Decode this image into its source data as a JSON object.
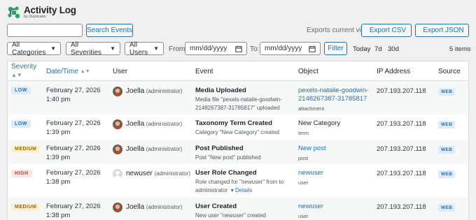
{
  "header": {
    "title": "Activity Log",
    "subtitle": "by Duplicator"
  },
  "search": {
    "placeholder": "",
    "value": "",
    "button_label": "Search Events"
  },
  "exports": {
    "note": "Exports current view",
    "csv_label": "Export CSV",
    "json_label": "Export JSON"
  },
  "filters": {
    "category": "All Categories",
    "severity": "All Severities",
    "users": "All Users",
    "from_label": "From:",
    "from_placeholder": "mm/dd/yyyy",
    "to_label": "To:",
    "to_placeholder": "mm/dd/yyyy",
    "filter_button": "Filter",
    "quick": [
      "Today",
      "7d",
      "30d"
    ],
    "count": "5 items"
  },
  "columns": [
    "Severity",
    "Date/Time",
    "User",
    "Event",
    "Object",
    "IP Address",
    "Source"
  ],
  "rows": [
    {
      "severity": "LOW",
      "date": "February 27, 2026",
      "time": "1:40 pm",
      "user": "Joella",
      "role": "(administrator)",
      "event": "Media Uploaded",
      "desc1": "Media file \"pexels-natalie-goodwin-",
      "desc2": "2148267387-31785817\" uploaded",
      "object1": "pexels-natalie-goodwin-",
      "object2": "2148267387-31785817",
      "object_type": "attachment",
      "ip": "207.193.207.118",
      "source": "WEB"
    },
    {
      "severity": "LOW",
      "date": "February 27, 2026",
      "time": "1:39 pm",
      "user": "Joella",
      "role": "(administrator)",
      "event": "Taxonomy Term Created",
      "desc1": "Category \"New Category\" created",
      "object1": "New Category",
      "object_type": "term",
      "ip": "207.193.207.118",
      "source": "WEB"
    },
    {
      "severity": "MEDIUM",
      "date": "February 27, 2026",
      "time": "1:39 pm",
      "user": "Joella",
      "role": "(administrator)",
      "event": "Post Published",
      "desc1": "Post \"New post\" published",
      "object1": "New post",
      "object_type": "post",
      "ip": "207.193.207.118",
      "source": "WEB"
    },
    {
      "severity": "HIGH",
      "date": "February 27, 2026",
      "time": "1:38 pm",
      "user": "newuser",
      "role": "(administrator)",
      "event": "User Role Changed",
      "desc1": "Role changed for \"newuser\" from to",
      "desc2": "administrator",
      "details": "Details",
      "object1": "newuser",
      "object_type": "user",
      "ip": "207.193.207.118",
      "source": "WEB"
    },
    {
      "severity": "MEDIUM",
      "date": "February 27, 2026",
      "time": "1:38 pm",
      "user": "Joella",
      "role": "(administrator)",
      "event": "User Created",
      "desc1": "New user \"newuser\" created",
      "object1": "newuser",
      "object_type": "user",
      "ip": "207.193.207.118",
      "source": "WEB"
    }
  ]
}
